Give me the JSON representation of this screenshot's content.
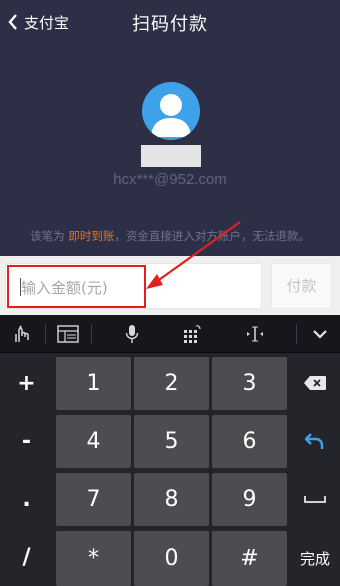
{
  "nav": {
    "back_label": "支付宝",
    "title": "扫码付款"
  },
  "payee": {
    "account": "hcx***@952.com"
  },
  "notice": {
    "prefix": "该笔为 ",
    "highlight": "即时到账",
    "suffix": "，资金直接进入对方账户，无法退款。"
  },
  "payment": {
    "amount_placeholder": "输入金额(元)",
    "pay_label": "付款"
  },
  "colors": {
    "header_bg": "#2c2f46",
    "avatar_blue": "#3da2e8",
    "highlight_orange": "#e0742b",
    "annotation_red": "#e2211f"
  },
  "keyboard": {
    "toolbar": [
      "touch-mode-icon",
      "layout-icon",
      "microphone-icon",
      "keypad-switch-icon",
      "cursor-move-icon",
      "chevron-down-icon"
    ],
    "side_left": [
      "+",
      "-",
      ".",
      "/"
    ],
    "digits": [
      "1",
      "2",
      "3",
      "4",
      "5",
      "6",
      "7",
      "8",
      "9",
      "*",
      "0",
      "#"
    ],
    "done_label": "完成"
  }
}
